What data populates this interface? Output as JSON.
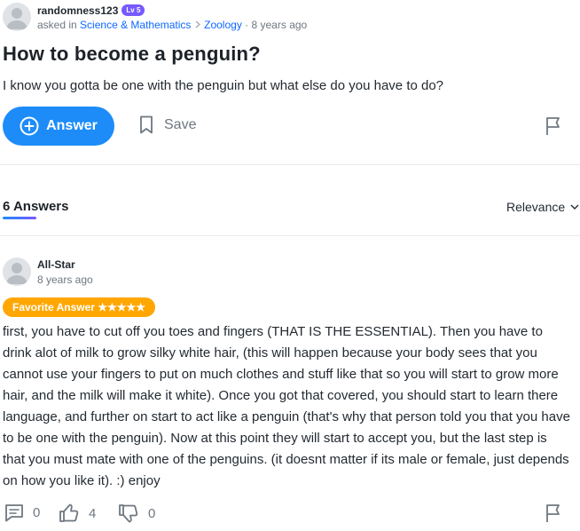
{
  "question": {
    "author": "randomness123",
    "level": "Lv 5",
    "asked_prefix": "asked in",
    "category": "Science & Mathematics",
    "breadcrumb_sep": ">",
    "subcategory": "Zoology",
    "time": "· 8 years ago",
    "title": "How to become a penguin?",
    "body": "I know you gotta be one with the penguin but what else do you have to do?"
  },
  "actions": {
    "answer_label": "Answer",
    "save_label": "Save"
  },
  "answers_header": {
    "count_label": "6 Answers",
    "sort_label": "Relevance"
  },
  "answer": {
    "author": "All-Star",
    "time": "8 years ago",
    "badge": "Favorite Answer ★★★★★",
    "text": "first, you have to cut off you toes and fingers (THAT IS THE ESSENTIAL). Then you have to drink alot of milk to grow silky white hair, (this will happen because your body sees that you cannot use your fingers to put on much clothes and stuff like that so you will start to grow more hair, and the milk will make it white). Once you got that covered, you should start to learn there language, and further on start to act like a penguin (that's  why that person told you that you have to be one with the penguin). Now at this point they will start to accept you, but the last step is that you must mate with one of the penguins. (it doesnt matter if its male or female, just depends on how you like it). :) enjoy",
    "comments": "0",
    "thumbs_up": "4",
    "thumbs_down": "0"
  },
  "colors": {
    "accent": "#1d8cf8",
    "badge_purple": "#7759ff",
    "favorite": "#ffa700"
  },
  "icons": [
    "avatar-icon",
    "plus-circle-icon",
    "bookmark-icon",
    "flag-icon",
    "chevron-down-icon",
    "comment-icon",
    "thumbs-up-icon",
    "thumbs-down-icon"
  ]
}
